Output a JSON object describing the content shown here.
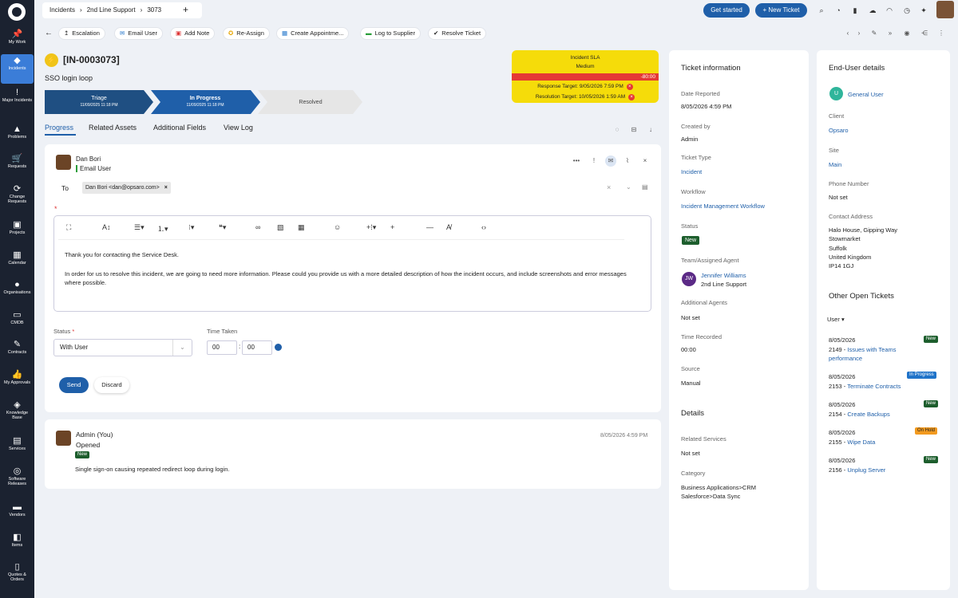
{
  "sidebar": {
    "items": [
      "My Work",
      "Incidents",
      "Major Incidents",
      "Problems",
      "Requests",
      "Change Requests",
      "Projects",
      "Calendar",
      "Organisations",
      "CMDB",
      "Contracts",
      "My Approvals",
      "Knowledge Base",
      "Services",
      "Software Releases",
      "Vendors",
      "Items",
      "Quotes & Orders"
    ]
  },
  "topbar": {
    "breadcrumb": [
      "Incidents",
      "2nd Line Support",
      "3073"
    ],
    "get_started": "Get started",
    "new_ticket": "+ New Ticket"
  },
  "actions": [
    "Escalation",
    "Email User",
    "Add Note",
    "Re-Assign",
    "Create Appointme...",
    "Log to Supplier",
    "Resolve Ticket"
  ],
  "ticket": {
    "id": "[IN-0003073]",
    "summary": "SSO login loop",
    "stages": [
      {
        "name": "Triage",
        "date": "11/09/2025 11:18 PM"
      },
      {
        "name": "In Progress",
        "date": "11/09/2025 11:18 PM"
      },
      {
        "name": "Resolved",
        "date": ""
      }
    ]
  },
  "sla": {
    "title": "Incident SLA",
    "priority": "Medium",
    "overdue": "-80:00",
    "response": "Response Target: 9/05/2026 7:59 PM",
    "resolution": "Resolution Target: 10/05/2026 1:59 AM"
  },
  "subtabs": [
    "Progress",
    "Related Assets",
    "Additional Fields",
    "View Log"
  ],
  "composer": {
    "from_name": "Dan Bori",
    "from_type": "Email User",
    "to_label": "To",
    "recipient": "Dan Bori <dan@opsaro.com>",
    "body_p1": "Thank you for contacting the Service Desk.",
    "body_p2": "In order for us to resolve this incident, we are going to need more information. Please could you provide us with a more detailed description of how the incident occurs, and include screenshots and error messages where possible.",
    "status_label": "Status",
    "status_value": "With User",
    "time_label": "Time Taken",
    "hours": "00",
    "minutes": "00",
    "send": "Send",
    "discard": "Discard"
  },
  "history": {
    "author": "Admin (You)",
    "action": "Opened",
    "status": "New",
    "date": "8/05/2026 4:59 PM",
    "note": "Single sign-on causing repeated redirect loop during login."
  },
  "ticket_info": {
    "heading": "Ticket information",
    "fields": [
      {
        "label": "Date Reported",
        "value": "8/05/2026 4:59 PM"
      },
      {
        "label": "Created by",
        "value": "Admin"
      },
      {
        "label": "Ticket Type",
        "value": "Incident"
      },
      {
        "label": "Workflow",
        "value": "Incident Management Workflow"
      },
      {
        "label": "Status",
        "value": "New"
      }
    ],
    "team_label": "Team/Assigned Agent",
    "agent_initials": "JW",
    "agent_name": "Jennifer Williams",
    "agent_team": "2nd Line Support",
    "additional_agents_label": "Additional Agents",
    "additional_agents": "Not set",
    "time_recorded_label": "Time Recorded",
    "time_recorded": "00:00",
    "source_label": "Source",
    "source": "Manual",
    "details_heading": "Details",
    "related_services_label": "Related Services",
    "related_services": "Not set",
    "category_label": "Category",
    "category_1": "Business Applications>CRM",
    "category_2": "Salesforce>Data Sync"
  },
  "enduser": {
    "heading": "End-User details",
    "initial": "U",
    "name": "General User",
    "client_label": "Client",
    "client": "Opsaro",
    "site_label": "Site",
    "site": "Main",
    "phone_label": "Phone Number",
    "phone": "Not set",
    "address_label": "Contact Address",
    "address": [
      "Halo House, Gipping Way",
      "Stowmarket",
      "Suffolk",
      "United Kingdom",
      "IP14 1GJ"
    ],
    "other_heading": "Other Open Tickets",
    "filter": "User",
    "tickets": [
      {
        "date": "8/05/2026",
        "id": "2149",
        "title": "Issues with Teams performance",
        "status": "New"
      },
      {
        "date": "8/05/2026",
        "id": "2153",
        "title": "Terminate Contracts",
        "status": "In Progress"
      },
      {
        "date": "8/05/2026",
        "id": "2154",
        "title": "Create Backups",
        "status": "New"
      },
      {
        "date": "8/05/2026",
        "id": "2155",
        "title": "Wipe Data",
        "status": "On Hold"
      },
      {
        "date": "8/05/2026",
        "id": "2156",
        "title": "Unplug Server",
        "status": "New"
      }
    ]
  }
}
